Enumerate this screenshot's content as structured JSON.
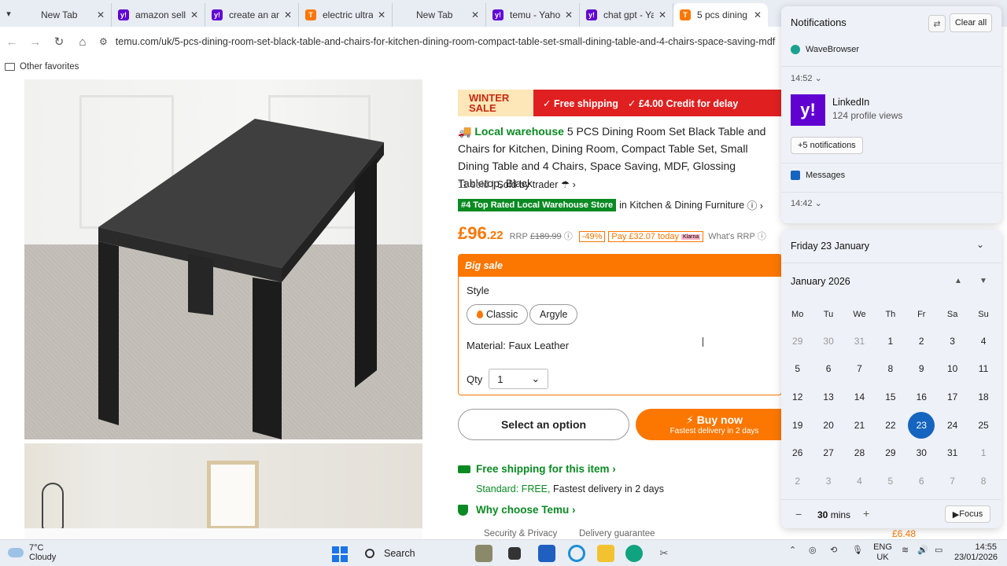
{
  "browser": {
    "tabs": [
      {
        "title": "New Tab",
        "icon": "blank-tab-icon",
        "active": false
      },
      {
        "title": "amazon selle",
        "icon": "yahoo-icon",
        "active": false
      },
      {
        "title": "create an am",
        "icon": "yahoo-icon",
        "active": false
      },
      {
        "title": "electric ultra",
        "icon": "temu-icon",
        "active": false
      },
      {
        "title": "New Tab",
        "icon": "blank-tab-icon",
        "active": false
      },
      {
        "title": "temu - Yahoo",
        "icon": "yahoo-icon",
        "active": false
      },
      {
        "title": "chat gpt - Ya",
        "icon": "yahoo-icon",
        "active": false
      },
      {
        "title": "5 pcs dining",
        "icon": "temu-icon",
        "active": true
      }
    ],
    "url": "temu.com/uk/5-pcs-dining-room-set-black-table-and-chairs-for-kitchen-dining-room-compact-table-set-small-dining-table-and-4-chairs-space-saving-mdf-glos",
    "favorites_folder": "Other favorites"
  },
  "product": {
    "promo": {
      "line1": "WINTER",
      "line2": "SALE",
      "item1": "✓ Free shipping",
      "item2": "✓ £4.00 Credit for delay"
    },
    "local_warehouse": "Local warehouse",
    "title": "5 PCS Dining Room Set Black Table and Chairs for Kitchen, Dining Room, Compact Table Set, Small Dining Table and 4 Chairs, Space Saving, MDF, Glossing Tabletop, Black",
    "sold": "11 sold",
    "sold_by": "Sold by trader",
    "rank_badge": "#4 Top Rated Local Warehouse Store",
    "rank_category": "in Kitchen & Dining Furniture",
    "price_main": "£96",
    "price_cents": ".22",
    "rrp_label": "RRP",
    "rrp_value": "£189.99",
    "discount": "-49%",
    "pay_later": "Pay £32.07 today",
    "klarna": "Klarna",
    "whats_rrp": "What's RRP",
    "big_sale": "Big sale",
    "style_label": "Style",
    "style_options": [
      "Classic",
      "Argyle"
    ],
    "material": "Material: Faux Leather",
    "qty_label": "Qty",
    "qty_value": "1",
    "select_option": "Select an option",
    "buy_now": "Buy now",
    "buy_now_sub": "Fastest delivery in 2 days",
    "free_shipping": "Free shipping for this item",
    "standard_free": "Standard: FREE,",
    "fastest": "Fastest delivery in 2 days",
    "why_temu": "Why choose Temu",
    "security": "Security & Privacy",
    "delivery_guarantee": "Delivery guarantee",
    "bottom_price": "£6.48"
  },
  "notifications": {
    "title": "Notifications",
    "clear_all": "Clear all",
    "app1": "WaveBrowser",
    "time1": "14:52",
    "linkedin_title": "LinkedIn",
    "linkedin_body": "124 profile views",
    "more": "+5 notifications",
    "app2": "Messages",
    "time2": "14:42"
  },
  "calendar": {
    "date_header": "Friday 23 January",
    "month": "January 2026",
    "weekdays": [
      "Mo",
      "Tu",
      "We",
      "Th",
      "Fr",
      "Sa",
      "Su"
    ],
    "days": [
      [
        "29",
        "30",
        "31",
        "1",
        "2",
        "3",
        "4"
      ],
      [
        "5",
        "6",
        "7",
        "8",
        "9",
        "10",
        "11"
      ],
      [
        "12",
        "13",
        "14",
        "15",
        "16",
        "17",
        "18"
      ],
      [
        "19",
        "20",
        "21",
        "22",
        "23",
        "24",
        "25"
      ],
      [
        "26",
        "27",
        "28",
        "29",
        "30",
        "31",
        "1"
      ],
      [
        "2",
        "3",
        "4",
        "5",
        "6",
        "7",
        "8"
      ]
    ],
    "today": "23",
    "focus_minutes": "30",
    "mins_label": "mins",
    "focus": "Focus"
  },
  "taskbar": {
    "temp": "7°C",
    "weather": "Cloudy",
    "search": "Search",
    "lang1": "ENG",
    "lang2": "UK",
    "time": "14:55",
    "date": "23/01/2026"
  },
  "colors": {
    "temu_orange": "#fb7701",
    "green": "#0a8a22",
    "promo_red": "#e02020",
    "calendar_today": "#1565c0"
  }
}
